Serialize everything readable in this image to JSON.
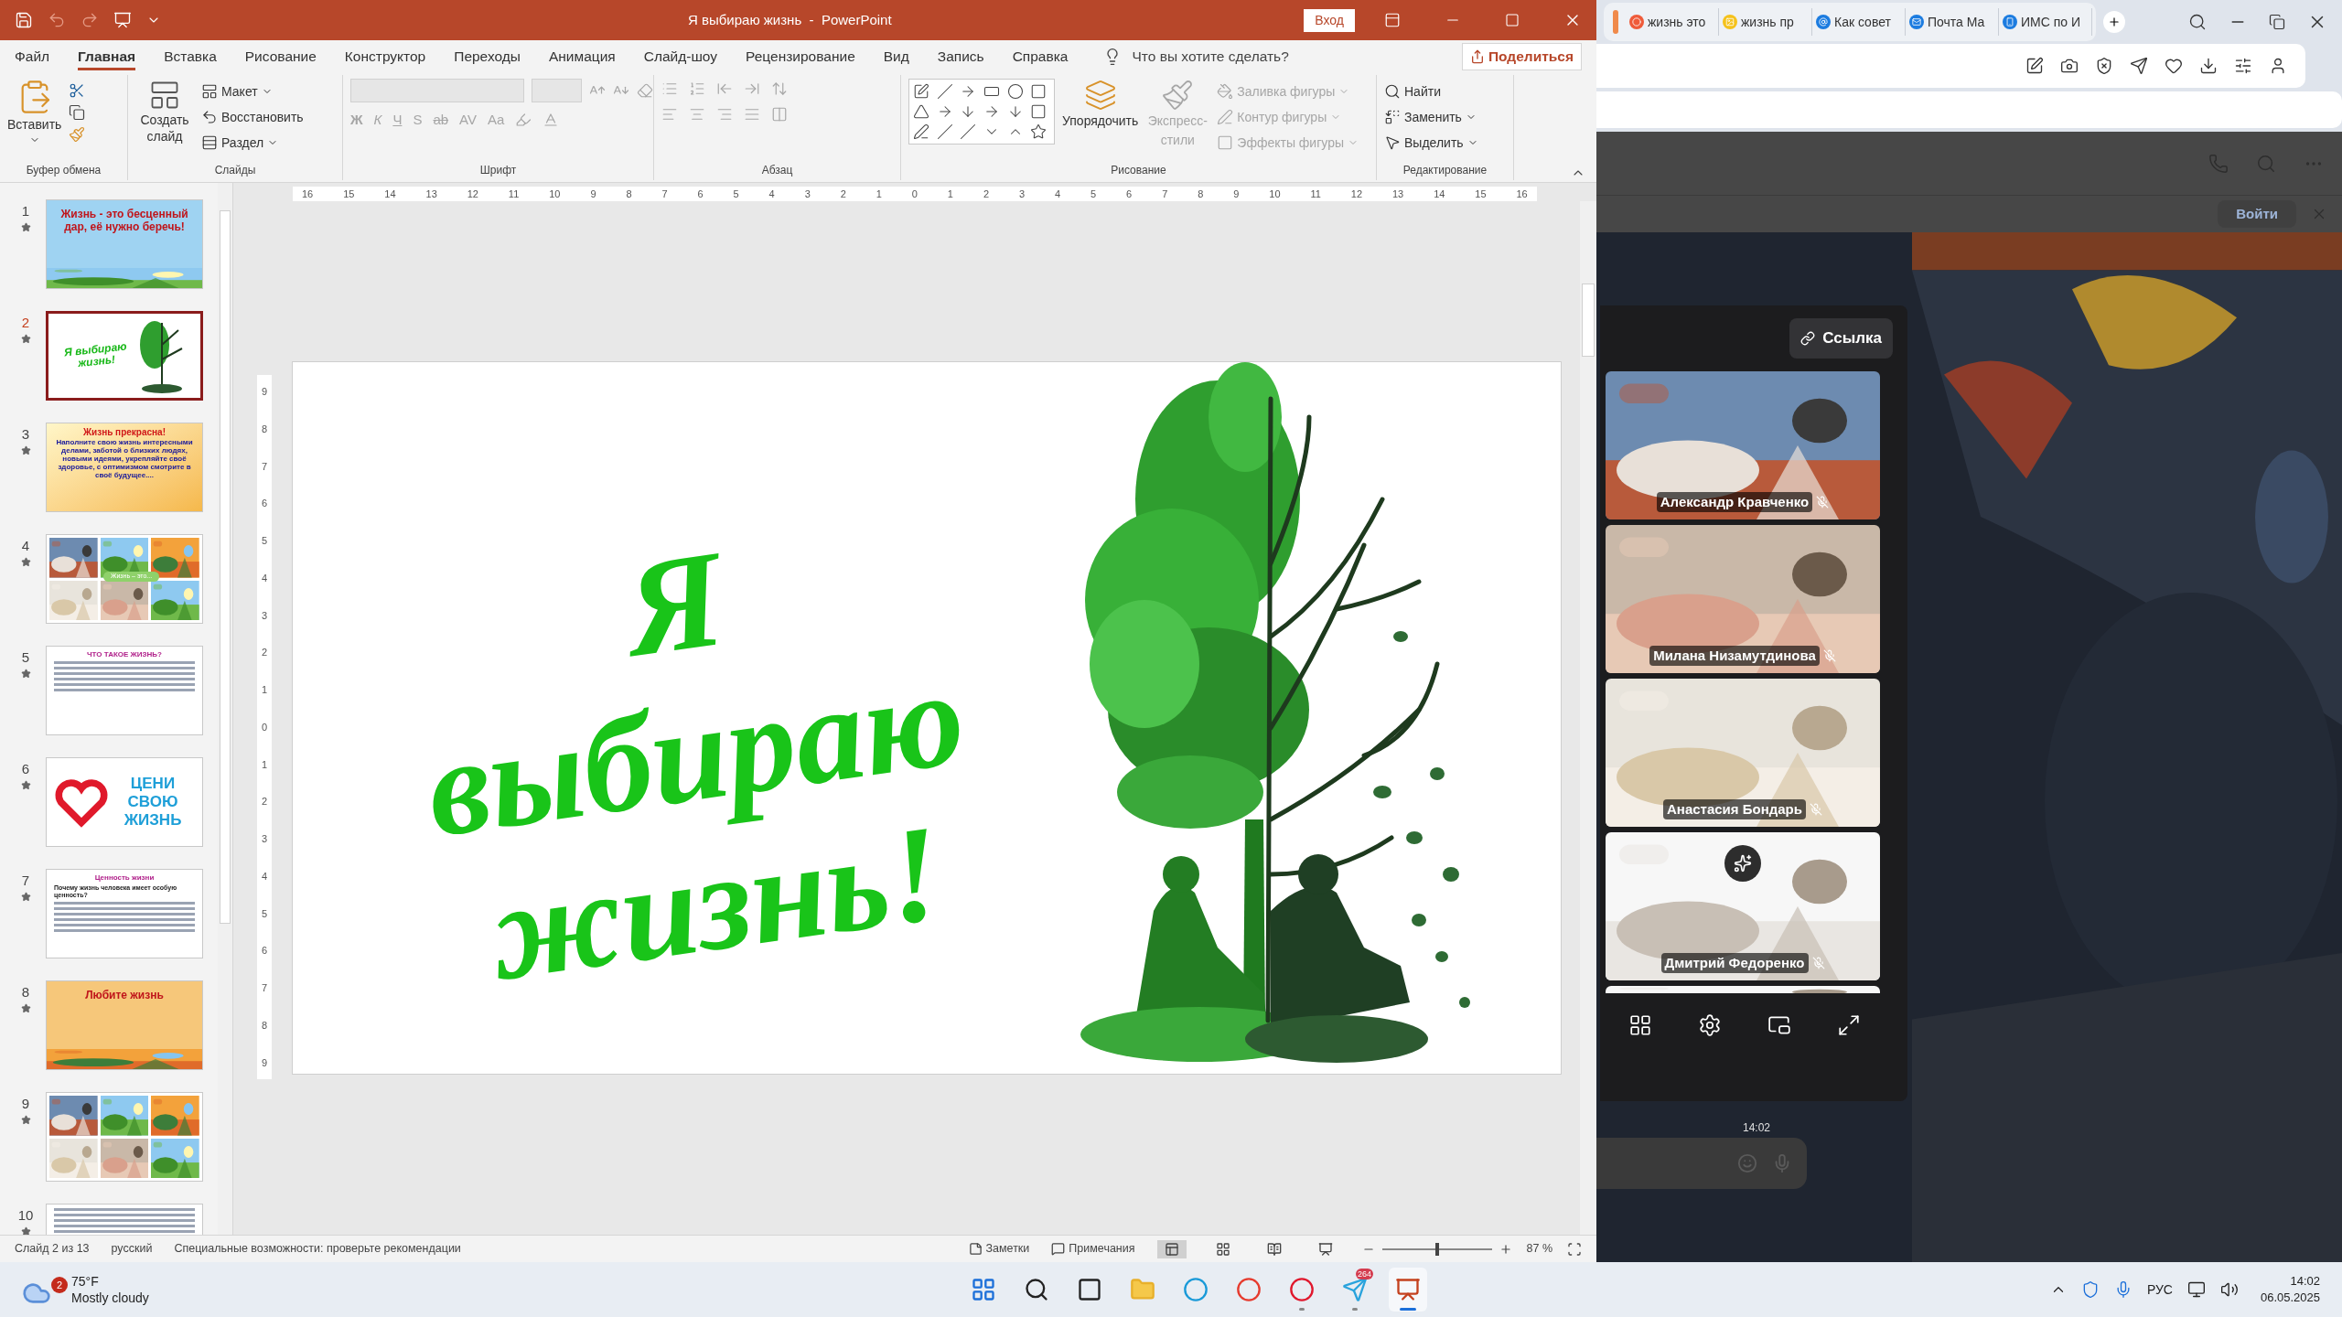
{
  "powerpoint": {
    "title": "Я выбираю жизнь  -  PowerPoint",
    "signin": "Вход",
    "menu_tabs": [
      {
        "label": "Файл",
        "selected": false
      },
      {
        "label": "Главная",
        "selected": true
      },
      {
        "label": "Вставка",
        "selected": false
      },
      {
        "label": "Рисование",
        "selected": false
      },
      {
        "label": "Конструктор",
        "selected": false
      },
      {
        "label": "Переходы",
        "selected": false
      },
      {
        "label": "Анимация",
        "selected": false
      },
      {
        "label": "Слайд-шоу",
        "selected": false
      },
      {
        "label": "Рецензирование",
        "selected": false
      },
      {
        "label": "Вид",
        "selected": false
      },
      {
        "label": "Запись",
        "selected": false
      },
      {
        "label": "Справка",
        "selected": false
      }
    ],
    "tell_me": "Что вы хотите сделать?",
    "share": "Поделиться",
    "ribbon": {
      "clipboard": {
        "label": "Буфер обмена",
        "paste": "Вставить"
      },
      "slides": {
        "label": "Слайды",
        "new_slide": "Создать слайд",
        "layout": "Макет",
        "reset": "Восстановить",
        "section": "Раздел"
      },
      "font": {
        "label": "Шрифт",
        "buttons": [
          "Ж",
          "К",
          "Ч",
          "S",
          "ab",
          "AV",
          "Aa"
        ]
      },
      "paragraph": {
        "label": "Абзац"
      },
      "drawing": {
        "label": "Рисование",
        "arrange": "Упорядочить",
        "quick_styles": "Экспресс-стили",
        "fill": "Заливка фигуры",
        "outline": "Контур фигуры",
        "effects": "Эффекты фигуры",
        "disabled": true
      },
      "editing": {
        "label": "Редактирование",
        "find": "Найти",
        "replace": "Заменить",
        "select": "Выделить"
      }
    },
    "ruler": {
      "horizontal": [
        "16",
        "15",
        "14",
        "13",
        "12",
        "11",
        "10",
        "9",
        "8",
        "7",
        "6",
        "5",
        "4",
        "3",
        "2",
        "1",
        "0",
        "1",
        "2",
        "3",
        "4",
        "5",
        "6",
        "7",
        "8",
        "9",
        "10",
        "11",
        "12",
        "13",
        "14",
        "15",
        "16"
      ],
      "vertical": [
        "9",
        "8",
        "7",
        "6",
        "5",
        "4",
        "3",
        "2",
        "1",
        "0",
        "1",
        "2",
        "3",
        "4",
        "5",
        "6",
        "7",
        "8",
        "9"
      ]
    },
    "thumbnails": [
      {
        "number": "1",
        "selected": false,
        "kind": "title_picture",
        "title": "Жизнь - это бесценный дар, её нужно беречь!"
      },
      {
        "number": "2",
        "selected": true,
        "kind": "slide_copy",
        "title": "Я выбираю жизнь!"
      },
      {
        "number": "3",
        "selected": false,
        "kind": "text_card",
        "title": "Жизнь прекрасна!",
        "body": "Наполните свою жизнь интересными делами, заботой о близких людях, новыми идеями, укрепляйте своё здоровье, с оптимизмом смотрите в своё будущее...."
      },
      {
        "number": "4",
        "selected": false,
        "kind": "collage",
        "title": "Жизнь – это..."
      },
      {
        "number": "5",
        "selected": false,
        "kind": "doc",
        "title": "ЧТО ТАКОЕ ЖИЗНЬ?"
      },
      {
        "number": "6",
        "selected": false,
        "kind": "logo",
        "title": "ЦЕНИ СВОЮ ЖИЗНЬ"
      },
      {
        "number": "7",
        "selected": false,
        "kind": "doc",
        "title": "Ценность жизни",
        "body": "Почему жизнь человека имеет особую ценность?"
      },
      {
        "number": "8",
        "selected": false,
        "kind": "title_picture",
        "title": "Любите жизнь"
      },
      {
        "number": "9",
        "selected": false,
        "kind": "collage"
      },
      {
        "number": "10",
        "selected": false,
        "kind": "doc"
      }
    ],
    "slide": {
      "title_lines": [
        "Я",
        "выбираю",
        "жизнь!"
      ]
    },
    "status": {
      "slide": "Слайд 2 из 13",
      "language": "русский",
      "accessibility": "Специальные возможности: проверьте рекомендации",
      "notes": "Заметки",
      "comments": "Примечания",
      "views": [
        {
          "kind": "normal",
          "selected": true
        },
        {
          "kind": "sorter",
          "selected": false
        },
        {
          "kind": "reading",
          "selected": false
        },
        {
          "kind": "show",
          "selected": false
        }
      ],
      "zoom": "87 %",
      "level": 0.5
    }
  },
  "browser": {
    "tabs": [
      {
        "title": "жизнь это",
        "kind": "yandex"
      },
      {
        "title": "жизнь пр"
      },
      {
        "title": "Как совет",
        "kind": "at"
      },
      {
        "title": "Почта Ма",
        "kind": "mail"
      },
      {
        "title": "ИМС по И",
        "kind": "phone"
      }
    ],
    "signin": "Войти",
    "link": "Ссылка",
    "participants": [
      {
        "name": "Александр Кравченко",
        "muted": true,
        "effects": false
      },
      {
        "name": "Милана Низамутдинова",
        "muted": true,
        "effects": false
      },
      {
        "name": "Анастасия Бондарь",
        "muted": true,
        "effects": false
      },
      {
        "name": "Дмитрий Федоренко",
        "muted": true,
        "effects": true
      }
    ],
    "message_time": "14:02"
  },
  "taskbar": {
    "weather": {
      "temp": "75°F",
      "text": "Mostly cloudy",
      "badge": "2"
    },
    "apps": [
      {
        "kind": "start",
        "running": false,
        "selected": false
      },
      {
        "kind": "search",
        "running": false,
        "selected": false
      },
      {
        "kind": "taskview",
        "running": false,
        "selected": false
      },
      {
        "kind": "explorer",
        "running": false,
        "selected": false
      },
      {
        "kind": "edge",
        "running": false,
        "selected": false
      },
      {
        "kind": "yandex",
        "running": false,
        "selected": false
      },
      {
        "kind": "opera",
        "running": true,
        "selected": false
      },
      {
        "kind": "telegram",
        "running": true,
        "selected": false,
        "badge": "264"
      },
      {
        "kind": "powerpoint",
        "running": true,
        "selected": true
      }
    ],
    "language": "РУС",
    "time": "14:02",
    "date": "06.05.2025"
  }
}
